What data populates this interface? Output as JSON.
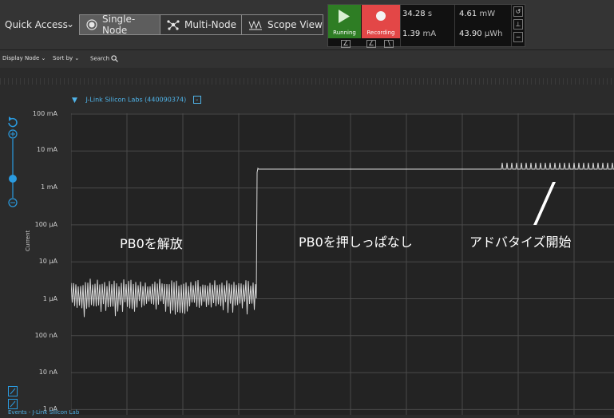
{
  "toolbar": {
    "quick_access": "Quick Access",
    "views": [
      {
        "label": "Single-Node",
        "icon": "single-node-icon",
        "active": true
      },
      {
        "label": "Multi-Node",
        "icon": "multi-node-icon",
        "active": false
      },
      {
        "label": "Scope View",
        "icon": "scope-view-icon",
        "active": false
      }
    ],
    "run": {
      "label": "Running",
      "color": "#2e7d24"
    },
    "record": {
      "label": "Recording",
      "color": "#e34747"
    },
    "measurements": {
      "time_value": "34.28",
      "time_unit": "s",
      "current_value": "1.39",
      "current_unit": "mA",
      "power_value": "4.61",
      "power_unit": "mW",
      "energy_value": "43.90",
      "energy_unit": "µWh"
    }
  },
  "filters": {
    "display_node": "Display Node",
    "sort_by": "Sort by",
    "search": "Search"
  },
  "device": {
    "name": "J-Link Silicon Labs (440090374)"
  },
  "chart": {
    "y_title": "Current",
    "y_ticks": [
      "100 mA",
      "10 mA",
      "1 mA",
      "100 µA",
      "10 µA",
      "1 µA",
      "100 nA",
      "10 nA",
      "1 nA"
    ],
    "trace_color": "#d7d7d7"
  },
  "annotations": {
    "released": "PB0を解放",
    "held": "PB0を押しっぱなし",
    "advertising": "アドバタイズ開始"
  },
  "footer": {
    "events_label": "Events - J-Link Silicon Lab"
  }
}
